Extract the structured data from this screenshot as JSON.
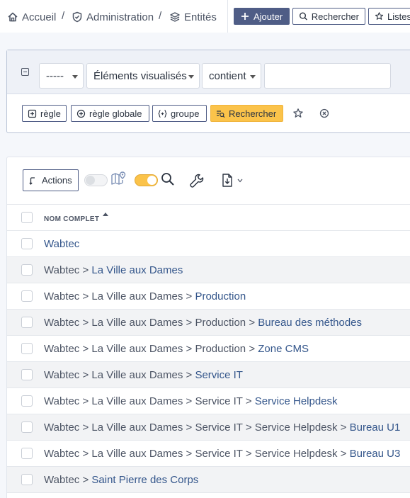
{
  "breadcrumb": {
    "home": "Accueil",
    "sep1": "/",
    "admin": "Administration",
    "sep2": "/",
    "entities": "Entités"
  },
  "toolbar": {
    "add_label": "Ajouter",
    "search_label": "Rechercher",
    "lists_label": "Listes"
  },
  "criteria": {
    "field_select": "-----",
    "scope_select": "Éléments visualisés",
    "operator_select": "contient",
    "value": "",
    "buttons": {
      "rule": "règle",
      "global_rule": "règle globale",
      "group": "groupe",
      "search": "Rechercher"
    }
  },
  "results": {
    "actions_label": "Actions",
    "map_toggle_on": false,
    "filter_toggle_on": true,
    "column_header": "NOM COMPLET",
    "sort": "ascending",
    "rows": [
      {
        "prefix": "",
        "link": "Wabtec"
      },
      {
        "prefix": "Wabtec >",
        "link": "La Ville aux Dames"
      },
      {
        "prefix": "Wabtec > La Ville aux Dames >",
        "link": "Production"
      },
      {
        "prefix": "Wabtec > La Ville aux Dames > Production >",
        "link": "Bureau des méthodes"
      },
      {
        "prefix": "Wabtec > La Ville aux Dames > Production >",
        "link": "Zone CMS"
      },
      {
        "prefix": "Wabtec > La Ville aux Dames >",
        "link": "Service IT"
      },
      {
        "prefix": "Wabtec > La Ville aux Dames > Service IT >",
        "link": "Service Helpdesk"
      },
      {
        "prefix": "Wabtec > La Ville aux Dames > Service IT > Service Helpdesk >",
        "link": "Bureau U1"
      },
      {
        "prefix": "Wabtec > La Ville aux Dames > Service IT > Service Helpdesk >",
        "link": "Bureau U3"
      },
      {
        "prefix": "Wabtec >",
        "link": "Saint Pierre des Corps"
      }
    ]
  },
  "colors": {
    "primary": "#4f5d86",
    "accent_yellow": "#fbc34a",
    "link": "#34568b",
    "text_muted": "#4d5565"
  },
  "icons": {
    "home": "home-icon",
    "admin": "shield-check-icon",
    "entities": "layers-icon",
    "add": "plus-icon",
    "search": "search-icon",
    "lists": "star-icon",
    "collapse": "minus-square-icon",
    "map": "map-pin-icon",
    "wrench": "wrench-icon",
    "export": "file-export-icon"
  }
}
